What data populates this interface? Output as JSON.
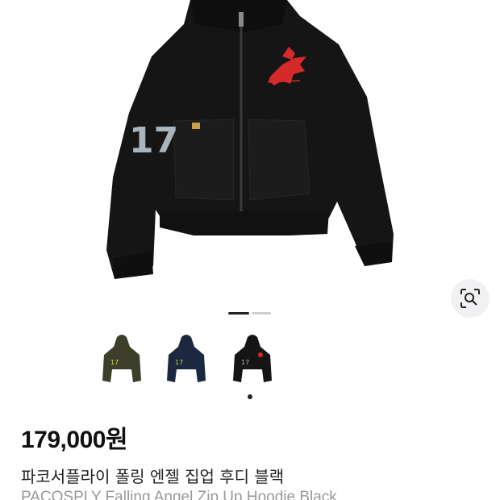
{
  "product": {
    "price": "179,000원",
    "title_ko": "파코서플라이 폴링 엔젤 집업 후디 블랙",
    "title_en": "PACOSPLY Falling Angel Zip Up Hoodie Black",
    "sleeve_number": "17"
  },
  "gallery": {
    "current_page": 1,
    "total_pages": 2
  },
  "thumbnails": [
    {
      "variant": "olive",
      "color": "#3d3f2a"
    },
    {
      "variant": "navy",
      "color": "#1c2740"
    },
    {
      "variant": "black",
      "color": "#151515"
    }
  ],
  "selected_thumbnail": 3,
  "icons": {
    "lens": "lens-search-icon"
  },
  "colors": {
    "hoodie": "#151515",
    "accent_red": "#d42a2a",
    "number_patch": "#a9b4bd"
  }
}
